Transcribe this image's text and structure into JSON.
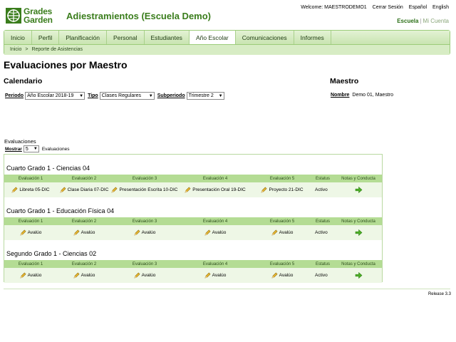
{
  "header": {
    "logo_line1": "Grades",
    "logo_line2": "Garden",
    "app_title": "Adiestramientos (Escuela Demo)",
    "welcome": "Welcome: MAESTRODEMO1",
    "logout": "Cerrar Sesión",
    "lang_es": "Español",
    "lang_en": "English",
    "school_link": "Escuela",
    "account_link": "Mi Cuenta",
    "separator": "|"
  },
  "nav": {
    "tabs": [
      "Inicio",
      "Perfil",
      "Planificación",
      "Personal",
      "Estudiantes",
      "Año Escolar",
      "Comunicaciones",
      "Informes"
    ],
    "active_tab": "Año Escolar",
    "breadcrumb": [
      "Inicio",
      "Reporte de Asistencias"
    ],
    "breadcrumb_sep": ">"
  },
  "page": {
    "title": "Evaluaciones por Maestro",
    "calendar_heading": "Calendario",
    "teacher_heading": "Maestro"
  },
  "filters": {
    "period_label": "Periodo",
    "period_value": "Año Escolar 2018-19",
    "type_label": "Tipo",
    "type_value": "Clases Regulares",
    "subperiod_label": "Subperiodo",
    "subperiod_value": "Trimestre 2"
  },
  "teacher": {
    "name_label": "Nombre",
    "name_value": "Demo 01, Maestro"
  },
  "evaluations": {
    "section_label": "Evaluaciones",
    "show_label": "Mostrar",
    "show_value": "5",
    "show_suffix": "Evaluaciones",
    "columns": [
      "Evaluación 1",
      "Evaluación 2",
      "Evaluación 3",
      "Evaluación 4",
      "Evaluación 5",
      "Estatus",
      "Notas y Conducta"
    ],
    "courses": [
      {
        "title": "Cuarto Grado 1 - Ciencias 04",
        "evaluations": [
          "Libreta 05-DIC",
          "Clase Diaria 07-DIC",
          "Presentación Escrita 10-DIC",
          "Presentación Oral 19-DIC",
          "Proyecto 21-DIC"
        ],
        "status": "Activo"
      },
      {
        "title": "Cuarto Grado 1 - Educación Física 04",
        "evaluations": [
          "Avalúo",
          "Avalúo",
          "Avalúo",
          "Avalúo",
          "Avalúo"
        ],
        "status": "Activo"
      },
      {
        "title": "Segundo Grado 1 - Ciencias 02",
        "evaluations": [
          "Avalúo",
          "Avalúo",
          "Avalúo",
          "Avalúo",
          "Avalúo"
        ],
        "status": "Activo"
      }
    ]
  },
  "footer": {
    "release": "Release 3.3"
  },
  "icons": {
    "logo": "grades-garden-logo-icon",
    "edit": "pencil-icon",
    "go": "green-arrow-right-icon",
    "dropdown": "chevron-down-icon"
  },
  "colors": {
    "brand": "#3a7d1c",
    "nav_bg": "#d7ecc4",
    "table_header": "#b4dc94",
    "row_bg": "#eef7e6"
  }
}
